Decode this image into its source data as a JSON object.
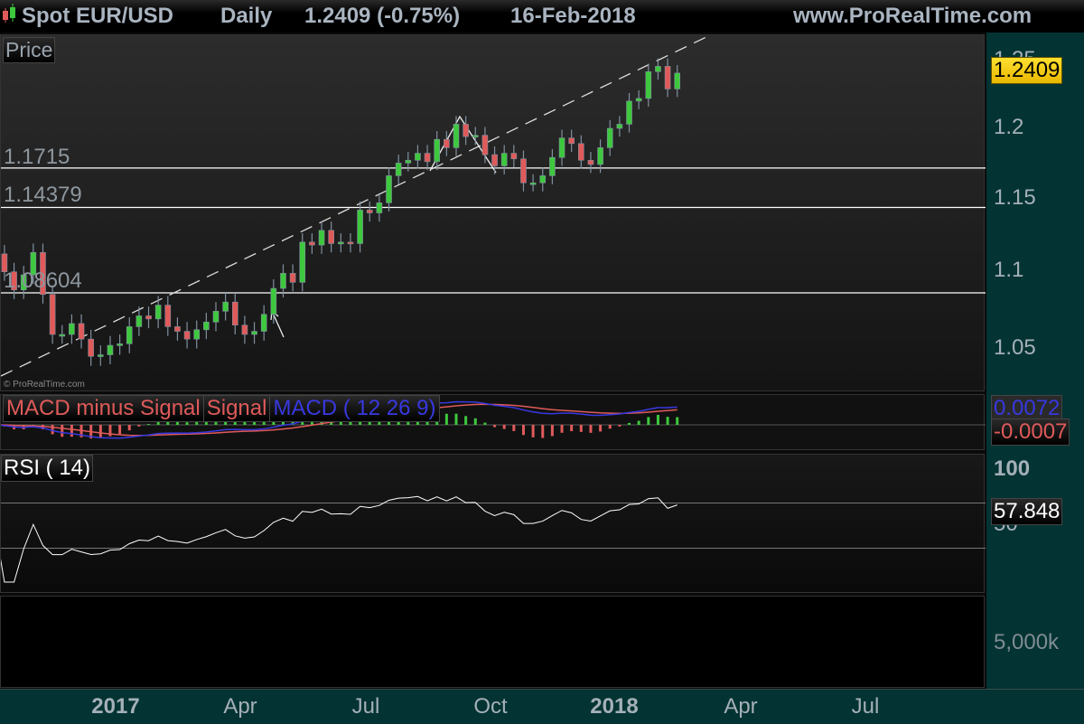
{
  "header": {
    "instrument": "Spot EUR/USD",
    "timeframe": "Daily",
    "last": "1.2409 (-0.75%)",
    "date": "16-Feb-2018",
    "site": "www.ProRealTime.com"
  },
  "price_panel": {
    "label": "Price",
    "copyright": "© ProRealTime.com",
    "levels": [
      "1.1715",
      "1.14379",
      "1.08604"
    ],
    "y_ticks": [
      "1.25",
      "1.2",
      "1.15",
      "1.1",
      "1.05"
    ],
    "last_price": "1.2409",
    "last_price_color": "#ffd000"
  },
  "macd_panel": {
    "legend": [
      "MACD minus Signal",
      "Signal",
      "MACD ( 12 26 9)"
    ],
    "legend_colors": [
      "#e05a5a",
      "#e05a5a",
      "#3838e0"
    ],
    "macd_value": "0.0072",
    "diff_value": "-0.0007"
  },
  "rsi_panel": {
    "label": "RSI ( 14)",
    "y_ticks": [
      "100",
      "50"
    ],
    "value": "57.848"
  },
  "volume_panel": {
    "y_ticks": [
      "5,000k"
    ]
  },
  "x_axis": {
    "ticks": [
      "2017",
      "Apr",
      "Jul",
      "Oct",
      "2018",
      "Apr",
      "Jul"
    ]
  },
  "chart_data": {
    "type": "candlestick",
    "title": "Spot EUR/USD Daily",
    "y_scale": "log",
    "ylim": [
      1.03,
      1.26
    ],
    "xlim": [
      "2016-10-01",
      "2018-09-30"
    ],
    "grid": false,
    "horizontal_levels": [
      1.1715,
      1.14379,
      1.08604
    ],
    "closes": [
      [
        "2016-10-07",
        1.112
      ],
      [
        "2016-10-14",
        1.1
      ],
      [
        "2016-10-21",
        1.088
      ],
      [
        "2016-10-28",
        1.098
      ],
      [
        "2016-11-04",
        1.113
      ],
      [
        "2016-11-11",
        1.085
      ],
      [
        "2016-11-18",
        1.059
      ],
      [
        "2016-11-25",
        1.059
      ],
      [
        "2016-12-02",
        1.066
      ],
      [
        "2016-12-09",
        1.056
      ],
      [
        "2016-12-16",
        1.045
      ],
      [
        "2016-12-23",
        1.046
      ],
      [
        "2016-12-30",
        1.052
      ],
      [
        "2017-01-06",
        1.053
      ],
      [
        "2017-01-13",
        1.064
      ],
      [
        "2017-01-20",
        1.071
      ],
      [
        "2017-01-27",
        1.069
      ],
      [
        "2017-02-03",
        1.078
      ],
      [
        "2017-02-10",
        1.064
      ],
      [
        "2017-02-17",
        1.061
      ],
      [
        "2017-02-24",
        1.056
      ],
      [
        "2017-03-03",
        1.062
      ],
      [
        "2017-03-10",
        1.067
      ],
      [
        "2017-03-17",
        1.074
      ],
      [
        "2017-03-24",
        1.08
      ],
      [
        "2017-03-31",
        1.065
      ],
      [
        "2017-04-07",
        1.059
      ],
      [
        "2017-04-14",
        1.061
      ],
      [
        "2017-04-21",
        1.072
      ],
      [
        "2017-04-28",
        1.089
      ],
      [
        "2017-05-05",
        1.099
      ],
      [
        "2017-05-12",
        1.093
      ],
      [
        "2017-05-19",
        1.12
      ],
      [
        "2017-05-26",
        1.118
      ],
      [
        "2017-06-02",
        1.128
      ],
      [
        "2017-06-09",
        1.119
      ],
      [
        "2017-06-16",
        1.12
      ],
      [
        "2017-06-23",
        1.119
      ],
      [
        "2017-06-30",
        1.142
      ],
      [
        "2017-07-07",
        1.14
      ],
      [
        "2017-07-14",
        1.147
      ],
      [
        "2017-07-21",
        1.166
      ],
      [
        "2017-07-28",
        1.175
      ],
      [
        "2017-08-04",
        1.177
      ],
      [
        "2017-08-11",
        1.182
      ],
      [
        "2017-08-18",
        1.176
      ],
      [
        "2017-08-25",
        1.192
      ],
      [
        "2017-09-01",
        1.186
      ],
      [
        "2017-09-08",
        1.203
      ],
      [
        "2017-09-15",
        1.194
      ],
      [
        "2017-09-22",
        1.195
      ],
      [
        "2017-09-29",
        1.181
      ],
      [
        "2017-10-06",
        1.173
      ],
      [
        "2017-10-13",
        1.182
      ],
      [
        "2017-10-20",
        1.178
      ],
      [
        "2017-10-27",
        1.161
      ],
      [
        "2017-11-03",
        1.161
      ],
      [
        "2017-11-10",
        1.166
      ],
      [
        "2017-11-17",
        1.179
      ],
      [
        "2017-11-24",
        1.193
      ],
      [
        "2017-12-01",
        1.189
      ],
      [
        "2017-12-08",
        1.177
      ],
      [
        "2017-12-15",
        1.174
      ],
      [
        "2017-12-22",
        1.186
      ],
      [
        "2017-12-29",
        1.2
      ],
      [
        "2018-01-05",
        1.203
      ],
      [
        "2018-01-12",
        1.22
      ],
      [
        "2018-01-19",
        1.222
      ],
      [
        "2018-01-26",
        1.242
      ],
      [
        "2018-02-02",
        1.246
      ],
      [
        "2018-02-09",
        1.229
      ],
      [
        "2018-02-16",
        1.2409
      ]
    ],
    "colors": {
      "up": "#3ec83e",
      "down": "#e05a5a",
      "wick": "#8090a0"
    }
  }
}
